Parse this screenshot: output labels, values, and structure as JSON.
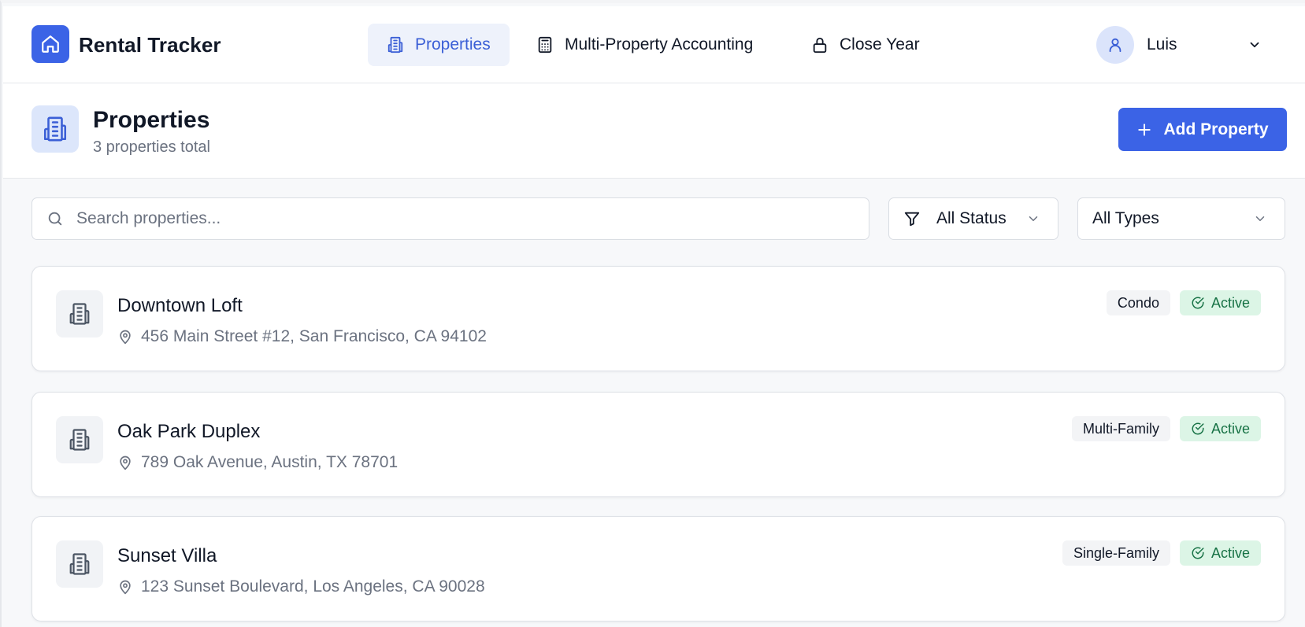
{
  "app": {
    "title": "Rental Tracker"
  },
  "nav": [
    {
      "label": "Properties",
      "icon": "building-icon",
      "active": true
    },
    {
      "label": "Multi-Property Accounting",
      "icon": "calculator-icon",
      "active": false
    },
    {
      "label": "Close Year",
      "icon": "lock-icon",
      "active": false
    }
  ],
  "user": {
    "name": "Luis"
  },
  "header": {
    "title": "Properties",
    "subtitle": "3 properties total",
    "add_button": "Add Property"
  },
  "filters": {
    "search_placeholder": "Search properties...",
    "search_value": "",
    "status_selected": "All Status",
    "type_selected": "All Types"
  },
  "properties": [
    {
      "name": "Downtown Loft",
      "address": "456 Main Street #12, San Francisco, CA 94102",
      "type": "Condo",
      "status": "Active"
    },
    {
      "name": "Oak Park Duplex",
      "address": "789 Oak Avenue, Austin, TX 78701",
      "type": "Multi-Family",
      "status": "Active"
    },
    {
      "name": "Sunset Villa",
      "address": "123 Sunset Boulevard, Los Angeles, CA 90028",
      "type": "Single-Family",
      "status": "Active"
    }
  ],
  "colors": {
    "accent": "#3b63e6",
    "active_nav_bg": "#eef2fb",
    "status_active_bg": "#dcf5e6",
    "status_active_text": "#177245"
  }
}
